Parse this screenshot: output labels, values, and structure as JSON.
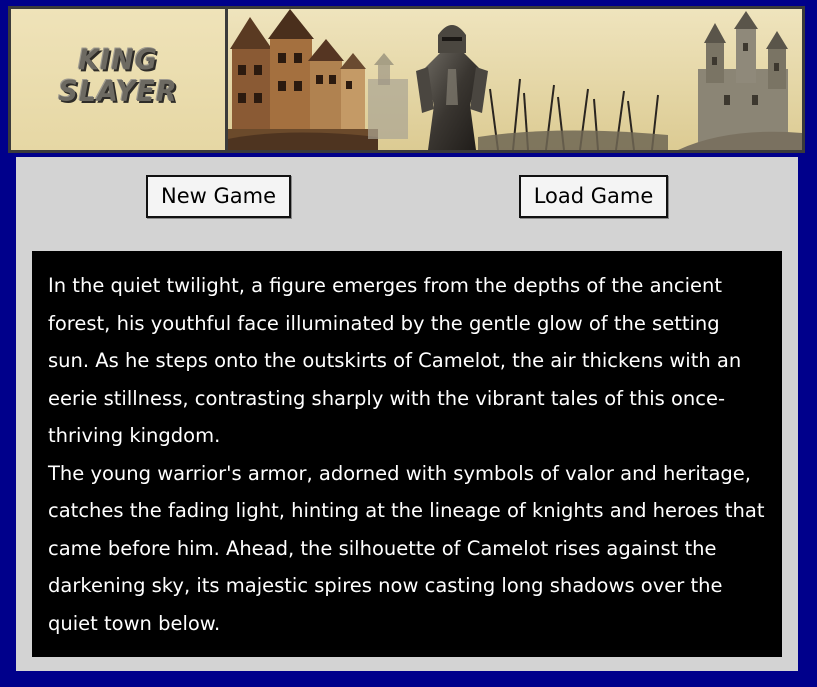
{
  "banner": {
    "logo_line1": "KING",
    "logo_line2": "SLAYER",
    "colors": {
      "background": "#00008b",
      "banner_paper": "#e9dcae",
      "panel": "#d3d3d3",
      "story_bg": "#000000",
      "story_text": "#ffffff"
    }
  },
  "menu": {
    "new_game_label": "New Game",
    "load_game_label": "Load Game"
  },
  "story": {
    "paragraph1": "In the quiet twilight, a figure emerges from the depths of the ancient forest, his youthful face illuminated by the gentle glow of the setting sun. As he steps onto the outskirts of Camelot, the air thickens with an eerie stillness, contrasting sharply with the vibrant tales of this once-thriving kingdom.",
    "paragraph2": "The young warrior's armor, adorned with symbols of valor and heritage, catches the fading light, hinting at the lineage of knights and heroes that came before him. Ahead, the silhouette of Camelot rises against the darkening sky, its majestic spires now casting long shadows over the quiet town below."
  }
}
